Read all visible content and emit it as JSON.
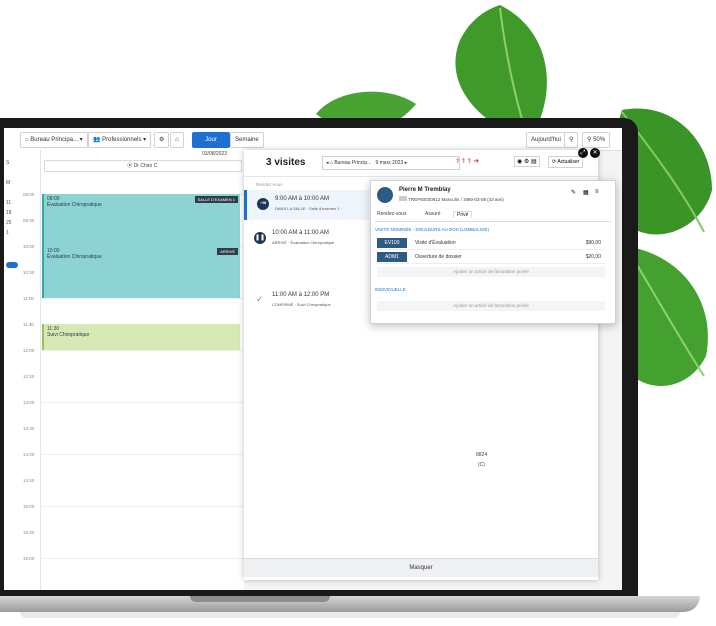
{
  "colors": {
    "leaf": "#3f9a2a",
    "accent_blue": "#1f6fd1",
    "event_teal": "#8ed3d3",
    "event_green": "#d7e8b5",
    "code_box": "#2d5b86"
  },
  "toolbar": {
    "office": "Bureau Principa...",
    "professionals": "Professionnels",
    "btn_jour": "Jour",
    "btn_semaine": "Semaine",
    "btn_today": "Aujourd'hui",
    "zoom": "50%",
    "date_short": "03/08/2023"
  },
  "calendar": {
    "column_title": "Dr Chiro C.",
    "rail": [
      "S",
      "M",
      "11",
      "18",
      "25",
      "1"
    ],
    "hours": [
      "09:00",
      "09:30",
      "10:00",
      "10:30",
      "11:00",
      "11:30",
      "12:00",
      "12:30",
      "13:00",
      "13:30",
      "14:00",
      "14:30",
      "15:00",
      "15:30",
      "16:00"
    ],
    "events": [
      {
        "time": "09:00",
        "title": "Évaluation Chiropratique",
        "tag": "SALLE D'EXAMEN 1"
      },
      {
        "time": "10:00",
        "title": "Évaluation Chiropratique",
        "tag": "ARRIVÉ"
      },
      {
        "time": "11:30",
        "title": "Suivi Chiropratique"
      }
    ]
  },
  "panel": {
    "title": "3 visites",
    "office": "Bureau Princip...",
    "date": "9 mars 2023",
    "refresh": "Actualiser",
    "section": "Rendez-vous",
    "visits": [
      {
        "time": "9:00 AM à 10:00 AM",
        "status": "DANS LA SALLE · Salle d'examen 1 ·"
      },
      {
        "time": "10:00 AM à 11:00 AM",
        "status": "ARRIVÉ · Évaluation Chiropratique"
      },
      {
        "time": "11:00 AM à 12:00 PM",
        "status": "CONFIRMÉ · Suivi Chiropratique"
      }
    ],
    "mid_text": "8824",
    "mid_text2": "(C)",
    "footer": "Masquer"
  },
  "popup": {
    "patient_name": "Pierre M Tremblay",
    "patient_id": "TREP80030812",
    "patient_info": "Masculin / 1980-03-08 (43 ans)",
    "tabs": [
      "Rendez-vous",
      "Assuré",
      "Privé"
    ],
    "section1": "VISITE NOMINÉE - DOULEURS AU DOS (LOMBALGIE)",
    "items": [
      {
        "code": "EV100",
        "desc": "Visite d'Évaluation",
        "price": "$90,00"
      },
      {
        "code": "ADM1",
        "desc": "Ouverture de dossier",
        "price": "$20,00"
      }
    ],
    "add_private": "Ajouter un article de facturation privée",
    "section2": "INDIVIDUELLE",
    "add_private2": "Ajouter un article de facturation privée"
  }
}
